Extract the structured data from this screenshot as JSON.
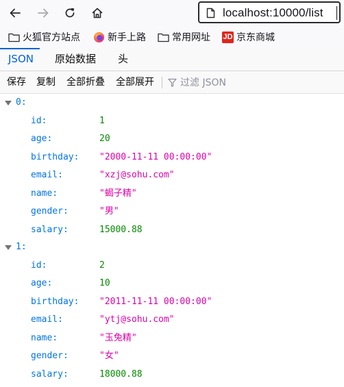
{
  "browser": {
    "url": "localhost:10000/list",
    "nav_icons": [
      "back-arrow-icon",
      "forward-arrow-icon",
      "reload-icon",
      "home-icon"
    ]
  },
  "bookmarks": [
    {
      "label": "火狐官方站点",
      "icon": "folder-icon"
    },
    {
      "label": "新手上路",
      "icon": "firefox-icon"
    },
    {
      "label": "常用网址",
      "icon": "folder-icon"
    },
    {
      "label": "京东商城",
      "icon": "jd-icon",
      "icon_text": "JD"
    }
  ],
  "tabs": [
    {
      "label": "JSON",
      "active": true
    },
    {
      "label": "原始数据",
      "active": false
    },
    {
      "label": "头",
      "active": false
    }
  ],
  "toolbar": {
    "save": "保存",
    "copy": "复制",
    "collapse_all": "全部折叠",
    "expand_all": "全部展开",
    "filter_placeholder": "过滤 JSON"
  },
  "records": [
    {
      "key": "0:",
      "fields": [
        {
          "key": "id:",
          "value": "1",
          "type": "number"
        },
        {
          "key": "age:",
          "value": "20",
          "type": "number"
        },
        {
          "key": "birthday:",
          "value": "\"2000-11-11 00:00:00\"",
          "type": "string"
        },
        {
          "key": "email:",
          "value": "\"xzj@sohu.com\"",
          "type": "string"
        },
        {
          "key": "name:",
          "value": "\"蝎子精\"",
          "type": "string"
        },
        {
          "key": "gender:",
          "value": "\"男\"",
          "type": "string"
        },
        {
          "key": "salary:",
          "value": "15000.88",
          "type": "number"
        }
      ]
    },
    {
      "key": "1:",
      "fields": [
        {
          "key": "id:",
          "value": "2",
          "type": "number"
        },
        {
          "key": "age:",
          "value": "10",
          "type": "number"
        },
        {
          "key": "birthday:",
          "value": "\"2011-11-11 00:00:00\"",
          "type": "string"
        },
        {
          "key": "email:",
          "value": "\"ytj@sohu.com\"",
          "type": "string"
        },
        {
          "key": "name:",
          "value": "\"玉兔精\"",
          "type": "string"
        },
        {
          "key": "gender:",
          "value": "\"女\"",
          "type": "string"
        },
        {
          "key": "salary:",
          "value": "18000.88",
          "type": "number"
        }
      ]
    }
  ],
  "colors": {
    "key": "#0074e8",
    "number": "#058b00",
    "string": "#dd00a9",
    "active_tab": "#0060df"
  }
}
